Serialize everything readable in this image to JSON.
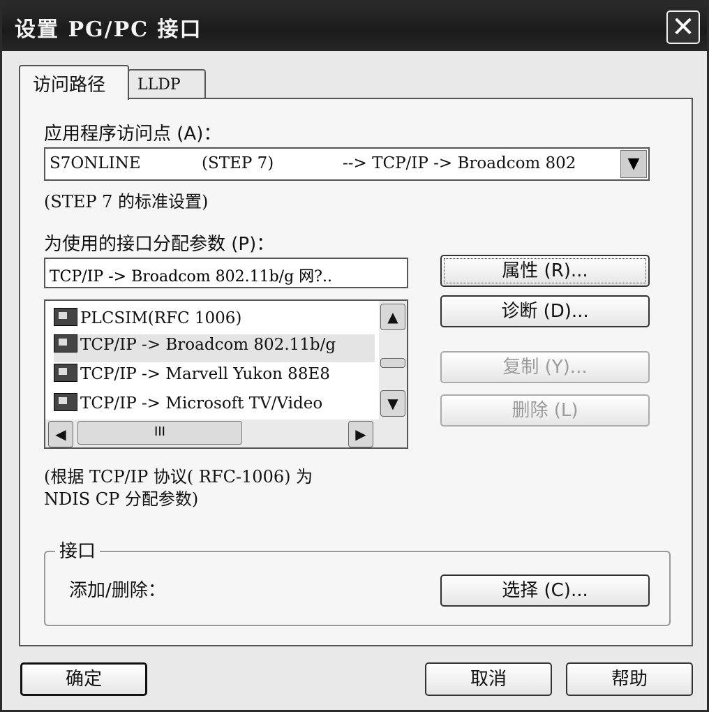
{
  "window": {
    "title": "设置 PG/PC 接口",
    "close_glyph": "✕"
  },
  "tabs": [
    {
      "label": "访问路径",
      "active": true
    },
    {
      "label": "LLDP",
      "active": false
    }
  ],
  "access_point": {
    "label": "应用程序访问点 (A)：",
    "value_name": "S7ONLINE",
    "value_app": "(STEP 7)",
    "value_path": "--> TCP/IP -> Broadcom 802",
    "description": "(STEP 7 的标准设置)",
    "dropdown_icon": "chevron-down-icon"
  },
  "interface_params": {
    "label": "为使用的接口分配参数 (P)：",
    "value": "TCP/IP -> Broadcom 802.11b/g 网?..",
    "items": [
      {
        "label": "PLCSIM(RFC 1006)",
        "icon": "network-card-icon",
        "selected": false
      },
      {
        "label": "TCP/IP -> Broadcom 802.11b/g",
        "icon": "network-card-icon",
        "selected": true
      },
      {
        "label": "TCP/IP -> Marvell Yukon 88E8",
        "icon": "network-card-icon",
        "selected": false
      },
      {
        "label": "TCP/IP -> Microsoft TV/Video",
        "icon": "network-card-icon",
        "selected": false
      }
    ],
    "scroll_up": "▲",
    "scroll_down": "▼",
    "scroll_left": "◀",
    "scroll_right": "▶",
    "thumb_grip": "III",
    "note_line1": "(根据 TCP/IP 协议( RFC-1006) 为",
    "note_line2": "NDIS CP 分配参数)"
  },
  "side_buttons": {
    "properties": "属性 (R)...",
    "diagnostics": "诊断 (D)...",
    "copy": "复制 (Y)...",
    "delete": "删除 (L)"
  },
  "interface_group": {
    "title": "接口",
    "label": "添加/删除：",
    "select_button": "选择 (C)..."
  },
  "footer": {
    "ok": "确定",
    "cancel": "取消",
    "help": "帮助"
  }
}
